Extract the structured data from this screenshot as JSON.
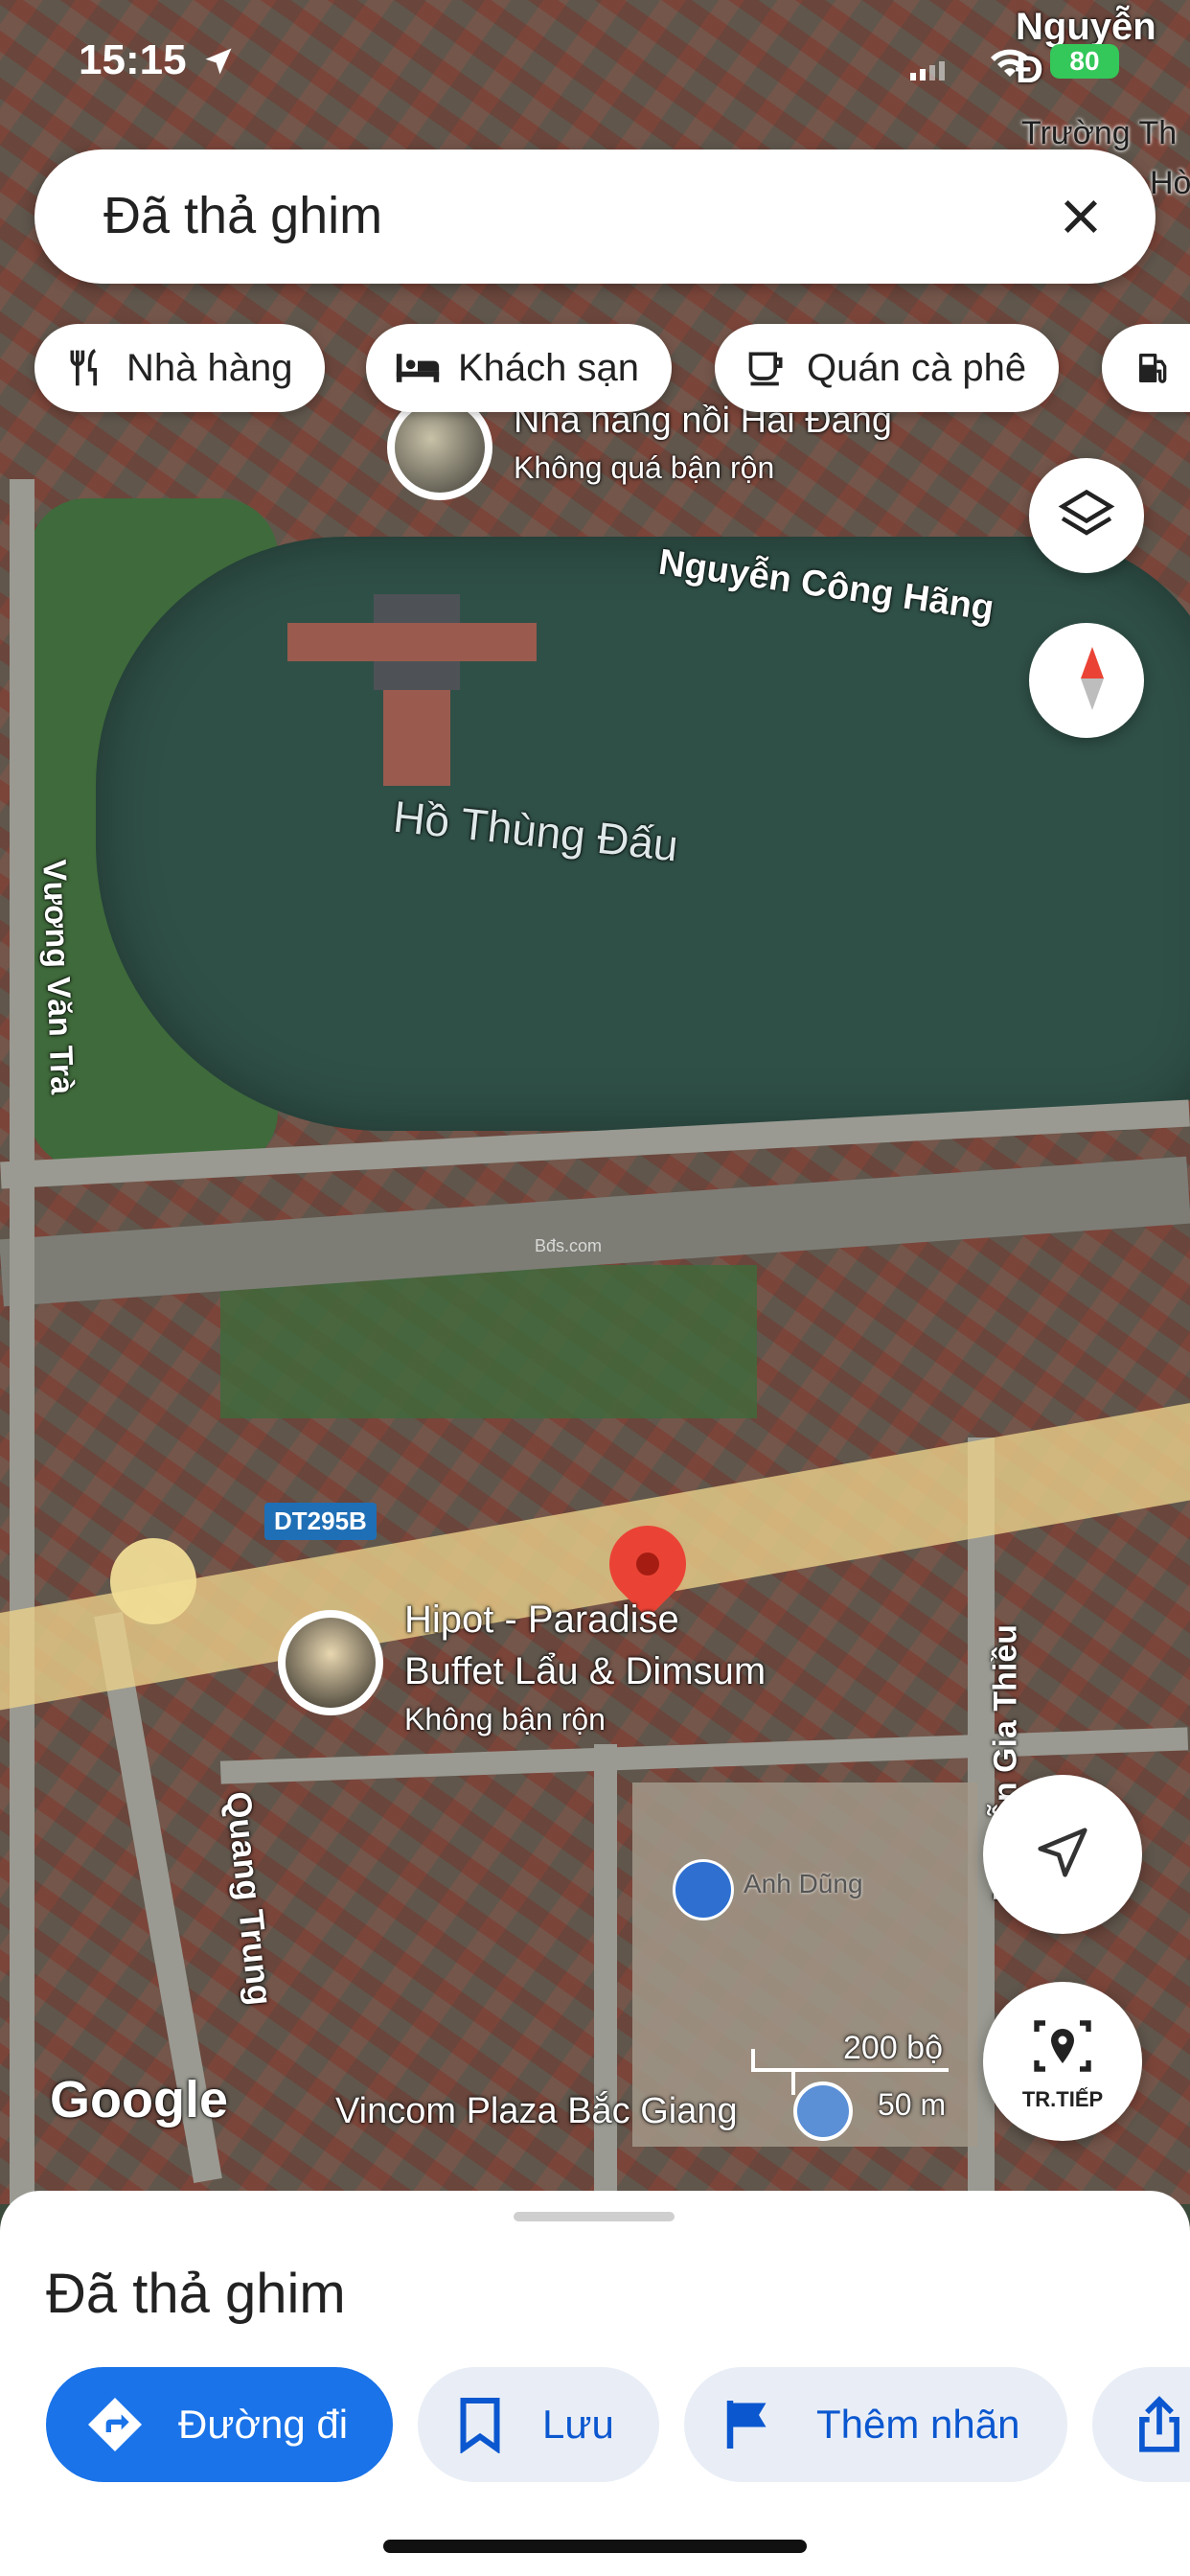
{
  "status_bar": {
    "time": "15:15",
    "battery": "80"
  },
  "search": {
    "value": "Đã thả ghim"
  },
  "chips": [
    {
      "label": "Nhà hàng",
      "icon": "restaurant-icon"
    },
    {
      "label": "Khách sạn",
      "icon": "hotel-icon"
    },
    {
      "label": "Quán cà phê",
      "icon": "coffee-icon"
    },
    {
      "label": "",
      "icon": "gas-station-icon"
    }
  ],
  "map": {
    "labels": {
      "top_street": "Nguyễn Đ",
      "school_line1": "Trường Th",
      "school_line2": "Hò",
      "poi_restaurant_name": "Nhà hàng nồi Hải Đăng",
      "poi_restaurant_status": "Không quá bận rộn",
      "street_nguyen_cong_hang": "Nguyễn Công Hãng",
      "lake_name": "Hồ Thùng Đấu",
      "street_vuong_van_tra": "Vương Văn Trà",
      "road_shield": "DT295B",
      "poi_hipot_name_line1": "Hipot - Paradise",
      "poi_hipot_name_line2": "Buffet Lẩu & Dimsum",
      "poi_hipot_status": "Không bận rộn",
      "street_quang_trung": "Quang Trung",
      "street_nguyen_gia_thieu": "Nguyễn Gia Thiều",
      "person_name": "Anh Dũng",
      "poi_vincom": "Vincom Plaza Bắc Giang",
      "watermark": "Bđs.com",
      "google_logo": "Google",
      "scale_imperial": "200 bộ",
      "scale_metric": "50 m"
    },
    "tr_tiep_label": "TR.TIẾP"
  },
  "sheet": {
    "title": "Đã thả ghim",
    "actions": [
      {
        "label": "Đường đi",
        "icon": "directions-icon"
      },
      {
        "label": "Lưu",
        "icon": "bookmark-icon"
      },
      {
        "label": "Thêm nhãn",
        "icon": "flag-icon"
      },
      {
        "label": "",
        "icon": "share-icon"
      }
    ]
  },
  "colors": {
    "accent": "#1a73e8",
    "pin": "#ea4335",
    "secondary_bg": "#e9eef6",
    "lake": "#2f5047"
  }
}
